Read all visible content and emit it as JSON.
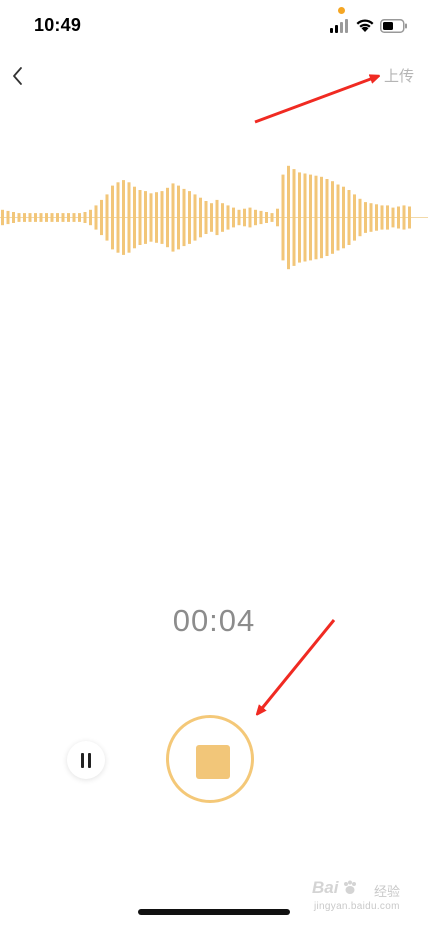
{
  "status_bar": {
    "time": "10:49",
    "recording_dot_color": "#f5a623",
    "icons": [
      "cellular-signal-icon",
      "wifi-icon",
      "battery-icon"
    ]
  },
  "nav": {
    "back_icon": "chevron-left-icon",
    "upload_label": "上传"
  },
  "waveform": {
    "color": "#f2c679",
    "levels": [
      0.14,
      0.12,
      0.1,
      0.08,
      0.08,
      0.08,
      0.08,
      0.08,
      0.08,
      0.08,
      0.08,
      0.08,
      0.08,
      0.08,
      0.08,
      0.1,
      0.14,
      0.22,
      0.32,
      0.42,
      0.58,
      0.64,
      0.68,
      0.64,
      0.56,
      0.5,
      0.48,
      0.44,
      0.46,
      0.48,
      0.54,
      0.62,
      0.58,
      0.52,
      0.48,
      0.42,
      0.36,
      0.3,
      0.26,
      0.32,
      0.26,
      0.22,
      0.18,
      0.14,
      0.16,
      0.18,
      0.14,
      0.12,
      0.1,
      0.08,
      0.16,
      0.78,
      0.94,
      0.88,
      0.82,
      0.8,
      0.78,
      0.76,
      0.74,
      0.7,
      0.66,
      0.6,
      0.56,
      0.5,
      0.42,
      0.34,
      0.28,
      0.26,
      0.24,
      0.22,
      0.22,
      0.18,
      0.2,
      0.22,
      0.2
    ]
  },
  "timer": "00:04",
  "controls": {
    "pause_icon": "pause-icon",
    "stop_icon": "stop-icon",
    "stop_color": "#f2c679",
    "ring_color": "#f4c878"
  },
  "annotation_color": "#f02a22",
  "watermark": {
    "brand": "Bai",
    "sub": "经验",
    "url": "jingyan.baidu.com"
  }
}
